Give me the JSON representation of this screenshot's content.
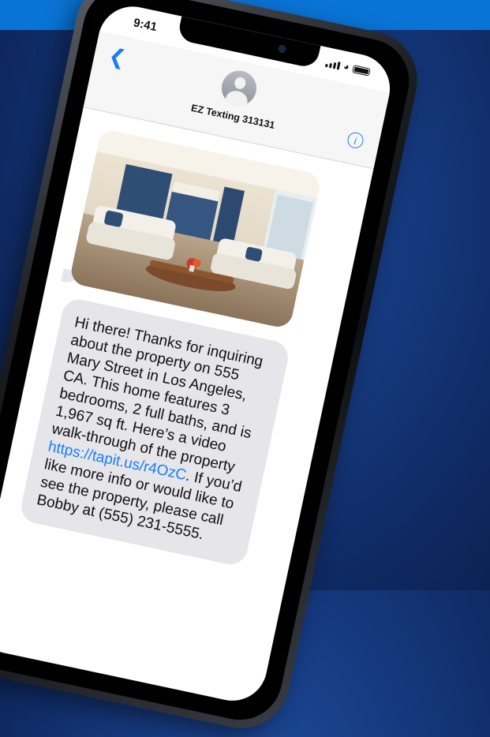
{
  "status_bar": {
    "time": "9:41"
  },
  "header": {
    "contact_name": "EZ Texting 313131"
  },
  "message": {
    "text_before_link": "Hi there! Thanks for inquiring about the property on 555 Mary Street in Los Angeles, CA. This home features 3 bedrooms, 2 full baths, and is 1,967 sq ft. Here’s a video walk-through of the property ",
    "link": "https://tapit.us/r4OzC",
    "text_after_link": ". If you’d like more info or would like to see the property, please call Bobby at (555) 231-5555."
  },
  "icons": {
    "back": "chevron-left-icon",
    "info": "info-icon",
    "avatar": "person-avatar",
    "signal": "cellular-signal-icon",
    "wifi": "wifi-icon",
    "battery": "battery-icon"
  },
  "colors": {
    "accent": "#1a7ef5",
    "bubble": "#e5e5ea",
    "top_band": "#0a74d6",
    "background": "#163a80"
  }
}
